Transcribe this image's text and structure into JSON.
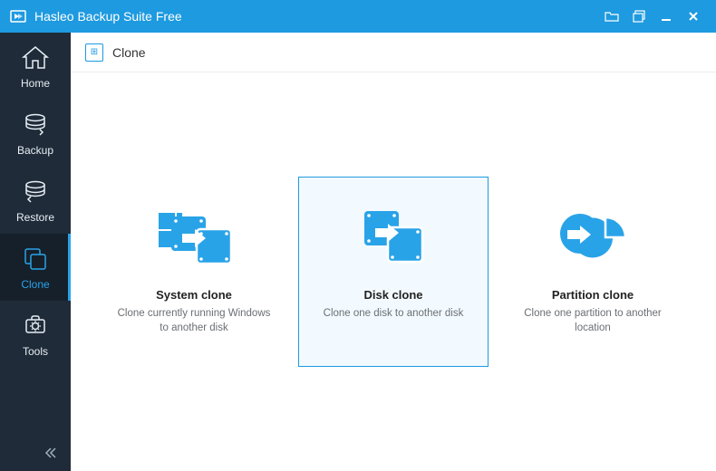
{
  "app": {
    "title": "Hasleo Backup Suite Free"
  },
  "sidebar": {
    "items": [
      {
        "label": "Home"
      },
      {
        "label": "Backup"
      },
      {
        "label": "Restore"
      },
      {
        "label": "Clone"
      },
      {
        "label": "Tools"
      }
    ]
  },
  "header": {
    "title": "Clone"
  },
  "cards": {
    "system": {
      "title": "System clone",
      "desc": "Clone currently running Windows to another disk"
    },
    "disk": {
      "title": "Disk clone",
      "desc": "Clone one disk to another disk"
    },
    "partition": {
      "title": "Partition clone",
      "desc": "Clone one partition to another location"
    }
  },
  "colors": {
    "accent": "#1e9ae0"
  }
}
